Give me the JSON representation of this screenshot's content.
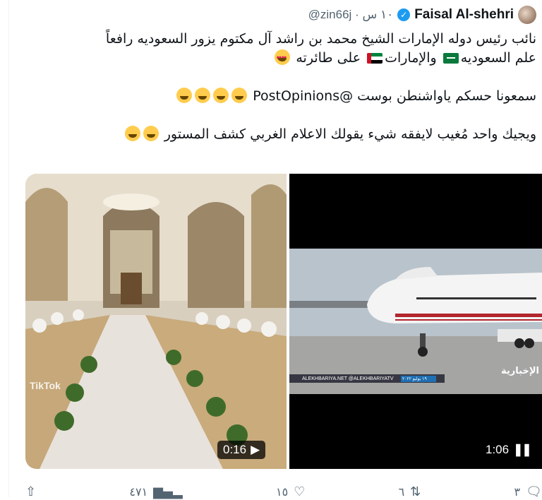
{
  "tweet": {
    "author_name": "Faisal Al-shehri",
    "handle": "@zin66j",
    "time": "· ١٠ س",
    "lines": [
      "نائب رئيس دوله الإمارات الشيخ محمد بن راشد آل مكتوم يزور السعوديه رافعاً",
      "علم السعوديه",
      "والإمارات",
      "على طائرته",
      "سمعونا حسكم ياواشنطن بوست @PostOpinions",
      "ويجيك واحد مُغيب لايفقه شيء يقولك الاعلام الغربي كشف المستور"
    ],
    "laugh_emoji": "🤣"
  },
  "media": {
    "left_video": {
      "duration": "0:16",
      "watermark": "TikTok",
      "control": "play"
    },
    "right_video": {
      "duration": "1:06",
      "control": "pause",
      "channel_logo": "الإخبارية",
      "ticker_left": "ALEKHBARIYA.NET  @ALEKHBARIYATV",
      "ticker_date": "١٩ يوليو ٢٠٢٢"
    }
  },
  "actions": {
    "reply_count": "٣",
    "retweet_count": "٦",
    "like_count": "١٥",
    "views_count": "٤٧١"
  },
  "colors": {
    "verified": "#1d9bf0",
    "muted": "#536471"
  }
}
